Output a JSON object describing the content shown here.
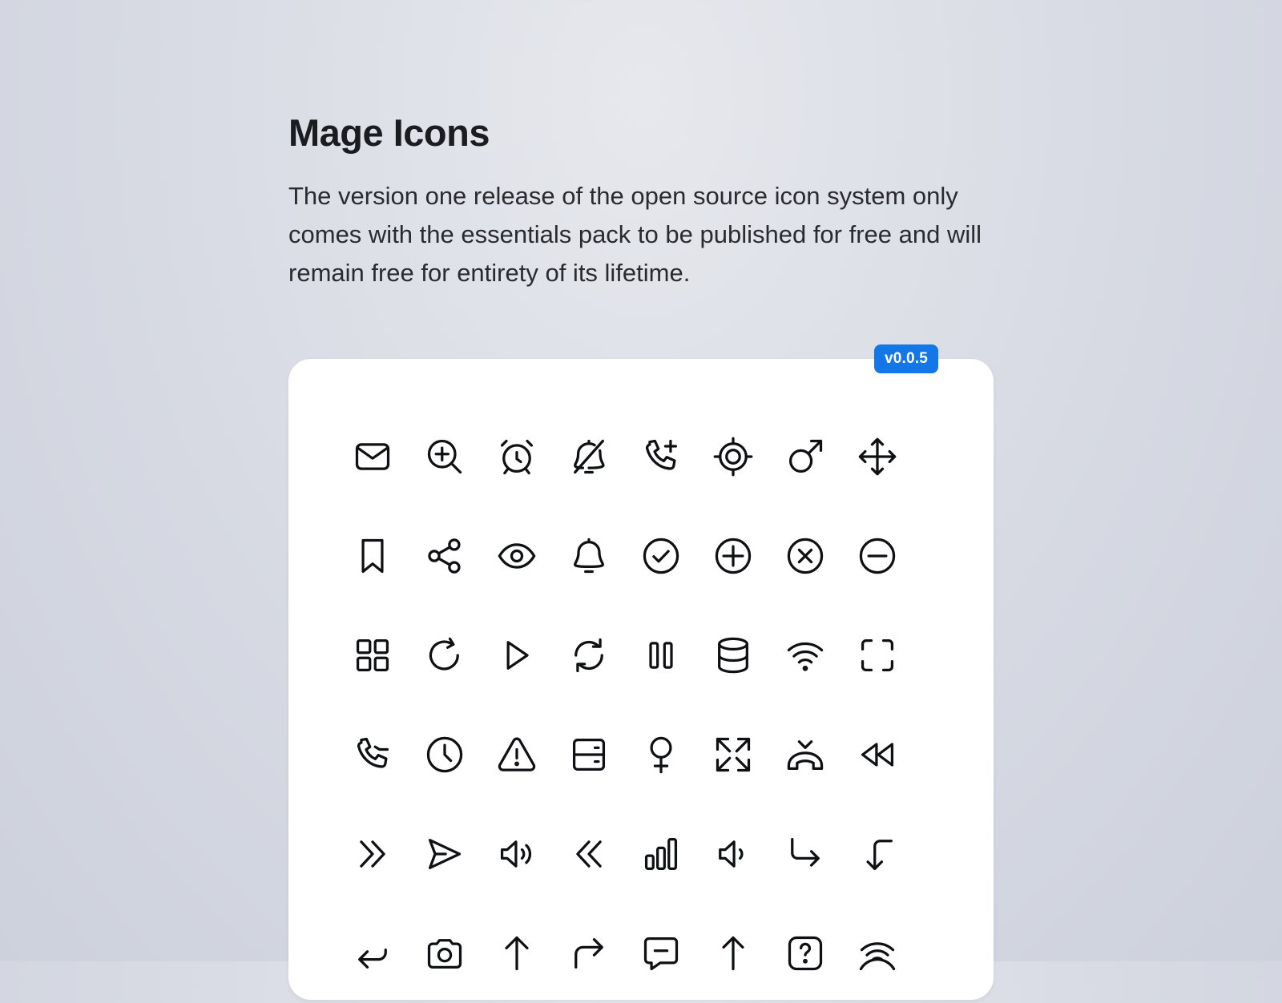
{
  "header": {
    "title": "Mage Icons",
    "description": "The version one release of the open source icon system only comes with the essentials pack to be published for free and will remain free for entirety of its lifetime."
  },
  "badge": {
    "label": "v0.0.5",
    "color": "#1477e8"
  },
  "icons": [
    [
      "email-icon",
      "zoom-in-icon",
      "alarm-clock-icon",
      "bell-off-icon",
      "phone-add-icon",
      "target-icon",
      "male-icon",
      "move-icon"
    ],
    [
      "bookmark-icon",
      "share-icon",
      "eye-icon",
      "bell-icon",
      "check-circle-icon",
      "plus-circle-icon",
      "close-circle-icon",
      "minus-circle-icon"
    ],
    [
      "dashboard-grid-icon",
      "redo-icon",
      "play-icon",
      "refresh-icon",
      "pause-icon",
      "database-icon",
      "wifi-icon",
      "fullscreen-icon"
    ],
    [
      "phone-incoming-icon",
      "clock-icon",
      "warning-triangle-icon",
      "server-icon",
      "female-icon",
      "maximize-icon",
      "phone-hangup-icon",
      "rewind-icon"
    ],
    [
      "chevron-double-right-icon",
      "send-icon",
      "volume-up-icon",
      "chevron-double-left-icon",
      "bar-chart-icon",
      "volume-down-icon",
      "arrow-turn-right-icon",
      "arrow-turn-down-icon"
    ],
    [
      "reply-icon",
      "camera-icon",
      "arrow-up-icon",
      "forward-icon",
      "message-minus-icon",
      "arrow-up-long-icon",
      "help-square-icon",
      "signal-stream-icon"
    ]
  ]
}
